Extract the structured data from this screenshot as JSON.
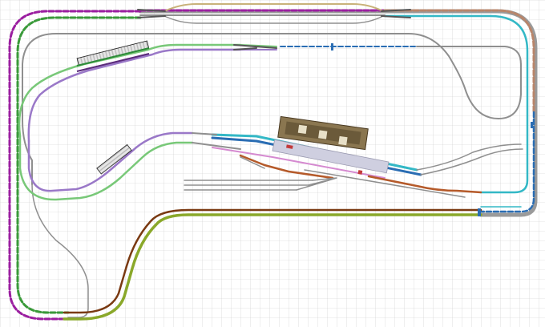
{
  "diagram": {
    "kind": "model railway track plan",
    "colors": {
      "grid": "#c9c9c9",
      "rail": "#8f8f8f",
      "magenta": "#9b1fa0",
      "green": "#3a9a3a",
      "olive": "#8aa82a",
      "brown": "#7a3a12",
      "rust": "#b55a2a",
      "cyan": "#33b8c6",
      "blue": "#2a6db3",
      "lavender": "#9a78c8",
      "lightgreen": "#78c878",
      "pink": "#d58ad0",
      "tan": "#c9b27a",
      "station": "#6b5a3a",
      "platform": "#cfcfe0"
    },
    "icons": [
      "switch-icon",
      "station-building-icon",
      "platform-icon",
      "signal-icon"
    ]
  }
}
